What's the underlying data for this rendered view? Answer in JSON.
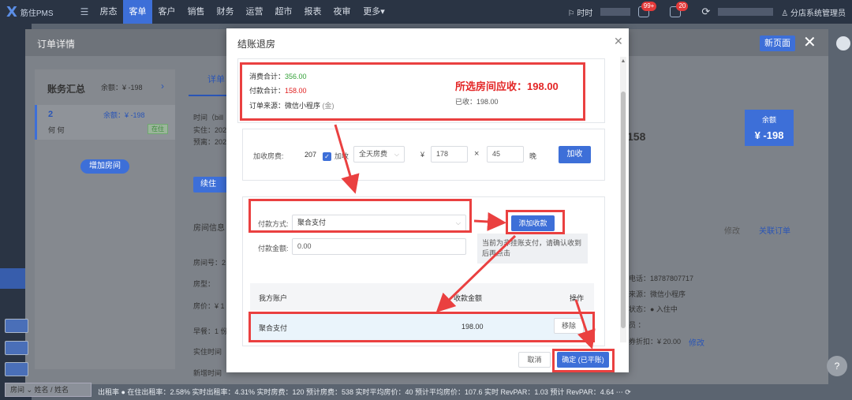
{
  "nav": {
    "logo_text": "筋住PMS",
    "items": [
      "房态",
      "客单",
      "客户",
      "销售",
      "财务",
      "运营",
      "超市",
      "报表",
      "夜审",
      "更多▾"
    ],
    "active_index": 1,
    "flag_label": "时时",
    "badge_one": "99+",
    "badge_two": "20",
    "user": "分店系统管理员"
  },
  "background": {
    "panel_title": "订单详情",
    "new_page_button": "新页面",
    "account_summary": "账务汇总",
    "balance_small": "余额：¥ -198",
    "room_number": "2",
    "room_balance": "余额：¥ -198",
    "guest_names": "何    何",
    "room_status": "在住",
    "add_room_button": "增加房间",
    "detail_tab": "详单",
    "time_label": "时间（bill",
    "checkin_label": "实住：202",
    "booking_label": "预离：202",
    "stay_button": "续住",
    "room_info": "房间信息",
    "room_no_label": "房间号：2",
    "room_type_label": "房型：",
    "room_price_label": "房价：¥ 1",
    "breakfast_label": "早餐：1 份",
    "actual_time_label": "实住时间",
    "new_time_label": "新增时间",
    "balance_label": "余额",
    "balance_value": "¥ -198",
    "mid_big_value": "158",
    "modify_link": "修改",
    "link_order": "关联订单",
    "phone": "电话：18787807717",
    "source": "来源：微信小程序",
    "status": "状态：● 入住中",
    "member": "员  ：",
    "coupon": "券折扣：¥ 20.00",
    "coupon_modify": "修改",
    "search_placeholder": "房间 ⌄  姓名 / 姓名"
  },
  "statusbar": "出租率 ● 在住出租率：2.58%   实时出租率：4.31%   实时房费：120   预计房费：538   实时平均房价：40   预计平均房价：107.6   实时 RevPAR：1.03   预计 RevPAR：4.64   ⋯   ⟳",
  "modal": {
    "title": "结账退房",
    "summary": {
      "consume_label": "消费合计：",
      "consume_value": "356.00",
      "payment_label": "付款合计：",
      "payment_value": "158.00",
      "source_label": "订单来源：",
      "source_value": "微信小程序",
      "source_tag": "(金)",
      "receivable_label": "所选房间应收：",
      "receivable_value": "198.00",
      "received_label": "已收：",
      "received_value": "198.00"
    },
    "charge": {
      "label": "加收房费:",
      "room": "207",
      "check_label": "加收",
      "type_value": "全天房费",
      "currency": "¥",
      "price_value": "178",
      "times": "×",
      "percent_value": "45",
      "unit": "晚",
      "button": "加收"
    },
    "payment": {
      "method_label": "付款方式:",
      "method_value": "聚合支付",
      "amount_label": "付款金额:",
      "amount_value": "0.00",
      "add_button": "添加收款",
      "note": "当前为非挂账支付，请确认收到后再点击"
    },
    "table": {
      "headers": [
        "我方账户",
        "收款金额",
        "操作"
      ],
      "rows": [
        {
          "account": "聚合支付",
          "amount": "198.00",
          "action": "移除"
        }
      ]
    },
    "cancel_button": "取消",
    "confirm_button": "确定 (已平账)"
  },
  "colors": {
    "accent": "#3d6fd8",
    "annotation_red": "#ea4040",
    "amount_red": "#e32626",
    "green": "#33a138"
  }
}
